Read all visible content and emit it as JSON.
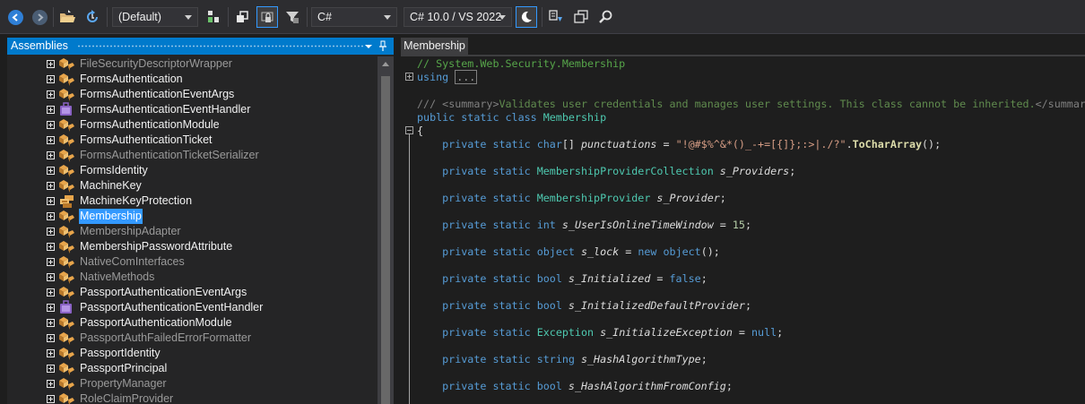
{
  "toolbar": {
    "language_filter": "(Default)",
    "language": "C#",
    "language_version": "C# 10.0 / VS 2022",
    "icons": [
      "back-arrow-icon",
      "forward-arrow-icon",
      "open-folder-icon",
      "reload-icon",
      "show-member-icon",
      "sort-icon",
      "lock-icon",
      "filter-icon",
      "theme-moon-icon",
      "search-assembly-icon",
      "window-icon",
      "magnifier-icon"
    ]
  },
  "assemblies_panel": {
    "title": "Assemblies",
    "items": [
      {
        "label": "FileSecurityDescriptorWrapper",
        "dim": true,
        "icon": "class-icon"
      },
      {
        "label": "FormsAuthentication",
        "dim": false,
        "icon": "class-icon"
      },
      {
        "label": "FormsAuthenticationEventArgs",
        "dim": false,
        "icon": "class-icon"
      },
      {
        "label": "FormsAuthenticationEventHandler",
        "dim": false,
        "icon": "delegate-icon"
      },
      {
        "label": "FormsAuthenticationModule",
        "dim": false,
        "icon": "class-icon"
      },
      {
        "label": "FormsAuthenticationTicket",
        "dim": false,
        "icon": "class-icon"
      },
      {
        "label": "FormsAuthenticationTicketSerializer",
        "dim": true,
        "icon": "class-icon"
      },
      {
        "label": "FormsIdentity",
        "dim": false,
        "icon": "class-icon"
      },
      {
        "label": "MachineKey",
        "dim": false,
        "icon": "class-icon"
      },
      {
        "label": "MachineKeyProtection",
        "dim": false,
        "icon": "enum-icon"
      },
      {
        "label": "Membership",
        "dim": false,
        "selected": true,
        "icon": "class-icon"
      },
      {
        "label": "MembershipAdapter",
        "dim": true,
        "icon": "class-icon"
      },
      {
        "label": "MembershipPasswordAttribute",
        "dim": false,
        "icon": "class-icon"
      },
      {
        "label": "NativeComInterfaces",
        "dim": true,
        "icon": "class-icon"
      },
      {
        "label": "NativeMethods",
        "dim": true,
        "icon": "class-icon"
      },
      {
        "label": "PassportAuthenticationEventArgs",
        "dim": false,
        "icon": "class-icon"
      },
      {
        "label": "PassportAuthenticationEventHandler",
        "dim": false,
        "icon": "delegate-icon"
      },
      {
        "label": "PassportAuthenticationModule",
        "dim": false,
        "icon": "class-icon"
      },
      {
        "label": "PassportAuthFailedErrorFormatter",
        "dim": true,
        "icon": "class-icon"
      },
      {
        "label": "PassportIdentity",
        "dim": false,
        "icon": "class-icon"
      },
      {
        "label": "PassportPrincipal",
        "dim": false,
        "icon": "class-icon"
      },
      {
        "label": "PropertyManager",
        "dim": true,
        "icon": "class-icon"
      },
      {
        "label": "RoleClaimProvider",
        "dim": true,
        "icon": "class-icon"
      }
    ]
  },
  "editor": {
    "tab_label": "Membership",
    "lines": [
      [
        {
          "t": "// System.Web.Security.Membership",
          "c": "c-comment"
        }
      ],
      [
        {
          "t": "using",
          "c": "c-kw"
        },
        {
          "t": " ",
          "c": "c-plain"
        },
        {
          "t": "...",
          "c": "collapsed"
        }
      ],
      [],
      [
        {
          "t": "/// ",
          "c": "c-doctag"
        },
        {
          "t": "<summary>",
          "c": "c-doctag"
        },
        {
          "t": "Validates user credentials and manages user settings. This class cannot be inherited.",
          "c": "c-doc"
        },
        {
          "t": "</summary>",
          "c": "c-doctag"
        }
      ],
      [
        {
          "t": "public static class ",
          "c": "c-kw"
        },
        {
          "t": "Membership",
          "c": "c-cls"
        }
      ],
      [
        {
          "t": "{",
          "c": "c-plain"
        }
      ],
      [
        {
          "t": "    private static ",
          "c": "c-kw"
        },
        {
          "t": "char",
          "c": "c-kw"
        },
        {
          "t": "[] ",
          "c": "c-plain"
        },
        {
          "t": "punctuations",
          "c": "c-field"
        },
        {
          "t": " = ",
          "c": "c-plain"
        },
        {
          "t": "\"!@#$%^&*()_-+=[{]};:>|./?\"",
          "c": "c-str"
        },
        {
          "t": ".",
          "c": "c-plain"
        },
        {
          "t": "ToCharArray",
          "c": "c-meth"
        },
        {
          "t": "();",
          "c": "c-plain"
        }
      ],
      [],
      [
        {
          "t": "    private static ",
          "c": "c-kw"
        },
        {
          "t": "MembershipProviderCollection",
          "c": "c-type"
        },
        {
          "t": " ",
          "c": "c-plain"
        },
        {
          "t": "s_Providers",
          "c": "c-field"
        },
        {
          "t": ";",
          "c": "c-plain"
        }
      ],
      [],
      [
        {
          "t": "    private static ",
          "c": "c-kw"
        },
        {
          "t": "MembershipProvider",
          "c": "c-type"
        },
        {
          "t": " ",
          "c": "c-plain"
        },
        {
          "t": "s_Provider",
          "c": "c-field"
        },
        {
          "t": ";",
          "c": "c-plain"
        }
      ],
      [],
      [
        {
          "t": "    private static ",
          "c": "c-kw"
        },
        {
          "t": "int",
          "c": "c-kw"
        },
        {
          "t": " ",
          "c": "c-plain"
        },
        {
          "t": "s_UserIsOnlineTimeWindow",
          "c": "c-field"
        },
        {
          "t": " = ",
          "c": "c-plain"
        },
        {
          "t": "15",
          "c": "c-num"
        },
        {
          "t": ";",
          "c": "c-plain"
        }
      ],
      [],
      [
        {
          "t": "    private static ",
          "c": "c-kw"
        },
        {
          "t": "object",
          "c": "c-kw"
        },
        {
          "t": " ",
          "c": "c-plain"
        },
        {
          "t": "s_lock",
          "c": "c-field"
        },
        {
          "t": " = ",
          "c": "c-plain"
        },
        {
          "t": "new ",
          "c": "c-kw"
        },
        {
          "t": "object",
          "c": "c-kw"
        },
        {
          "t": "();",
          "c": "c-plain"
        }
      ],
      [],
      [
        {
          "t": "    private static ",
          "c": "c-kw"
        },
        {
          "t": "bool",
          "c": "c-kw"
        },
        {
          "t": " ",
          "c": "c-plain"
        },
        {
          "t": "s_Initialized",
          "c": "c-field"
        },
        {
          "t": " = ",
          "c": "c-plain"
        },
        {
          "t": "false",
          "c": "c-kw"
        },
        {
          "t": ";",
          "c": "c-plain"
        }
      ],
      [],
      [
        {
          "t": "    private static ",
          "c": "c-kw"
        },
        {
          "t": "bool",
          "c": "c-kw"
        },
        {
          "t": " ",
          "c": "c-plain"
        },
        {
          "t": "s_InitializedDefaultProvider",
          "c": "c-field"
        },
        {
          "t": ";",
          "c": "c-plain"
        }
      ],
      [],
      [
        {
          "t": "    private static ",
          "c": "c-kw"
        },
        {
          "t": "Exception",
          "c": "c-type"
        },
        {
          "t": " ",
          "c": "c-plain"
        },
        {
          "t": "s_InitializeException",
          "c": "c-field"
        },
        {
          "t": " = ",
          "c": "c-plain"
        },
        {
          "t": "null",
          "c": "c-kw"
        },
        {
          "t": ";",
          "c": "c-plain"
        }
      ],
      [],
      [
        {
          "t": "    private static ",
          "c": "c-kw"
        },
        {
          "t": "string",
          "c": "c-kw"
        },
        {
          "t": " ",
          "c": "c-plain"
        },
        {
          "t": "s_HashAlgorithmType",
          "c": "c-field"
        },
        {
          "t": ";",
          "c": "c-plain"
        }
      ],
      [],
      [
        {
          "t": "    private static ",
          "c": "c-kw"
        },
        {
          "t": "bool",
          "c": "c-kw"
        },
        {
          "t": " ",
          "c": "c-plain"
        },
        {
          "t": "s_HashAlgorithmFromConfig",
          "c": "c-field"
        },
        {
          "t": ";",
          "c": "c-plain"
        }
      ]
    ]
  }
}
